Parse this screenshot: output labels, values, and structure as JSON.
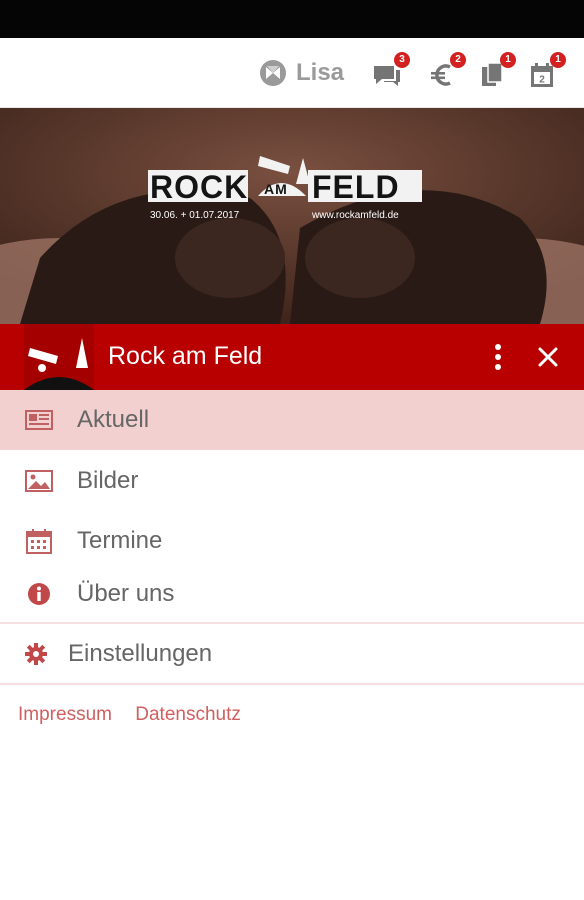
{
  "top_bar": {
    "user_name": "Lisa",
    "icons": [
      {
        "name": "chat-icon",
        "badge": "3"
      },
      {
        "name": "euro-icon",
        "badge": "2"
      },
      {
        "name": "documents-icon",
        "badge": "1"
      },
      {
        "name": "calendar-icon",
        "badge": "1"
      }
    ]
  },
  "hero": {
    "logo_rock": "ROCK",
    "logo_am": "AM",
    "logo_feld": "FELD",
    "dates": "30.06. + 01.07.2017",
    "website": "www.rockamfeld.de"
  },
  "drawer": {
    "title": "Rock am Feld",
    "items": [
      {
        "label": "Aktuell",
        "icon": "newspaper-icon",
        "active": true
      },
      {
        "label": "Bilder",
        "icon": "image-icon",
        "active": false
      },
      {
        "label": "Termine",
        "icon": "calendar-icon",
        "active": false
      },
      {
        "label": "Über uns",
        "icon": "info-icon",
        "active": false
      }
    ],
    "settings_label": "Einstellungen",
    "footer": {
      "impressum": "Impressum",
      "datenschutz": "Datenschutz"
    }
  },
  "colors": {
    "accent": "#b80000",
    "active_bg": "#f2d0d0",
    "badge": "#d32020",
    "link": "#d06060"
  }
}
